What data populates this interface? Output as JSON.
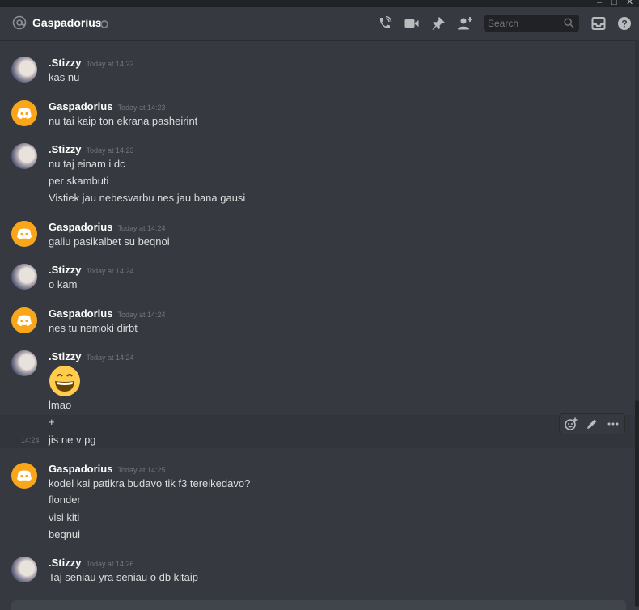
{
  "header": {
    "channel_name": "Gaspadorius",
    "search_placeholder": "Search"
  },
  "messages": [
    {
      "author": ".Stizzy",
      "time": "Today at 14:22",
      "lines": [
        "kas nu"
      ]
    },
    {
      "author": "Gaspadorius",
      "time": "Today at 14:23",
      "lines": [
        "nu tai kaip ton ekrana pasheirint"
      ]
    },
    {
      "author": ".Stizzy",
      "time": "Today at 14:23",
      "lines": [
        "nu taj einam i dc",
        "per skambuti",
        "Vistiek jau nebesvarbu nes jau bana gausi"
      ]
    },
    {
      "author": "Gaspadorius",
      "time": "Today at 14:24",
      "lines": [
        "galiu pasikalbet su beqnoi"
      ]
    },
    {
      "author": ".Stizzy",
      "time": "Today at 14:24",
      "lines": [
        "o kam"
      ]
    },
    {
      "author": "Gaspadorius",
      "time": "Today at 14:24",
      "lines": [
        "nes tu nemoki dirbt"
      ]
    },
    {
      "author": ".Stizzy",
      "time": "Today at 14:24",
      "lines": [
        "lmao",
        "+",
        "jis ne v pg"
      ],
      "emoji": "smile-emoji",
      "hover_time": "14:24"
    },
    {
      "author": "Gaspadorius",
      "time": "Today at 14:25",
      "lines": [
        "kodel kai patikra budavo tik f3 tereikedavo?",
        "flonder",
        "visi kiti",
        "beqnui"
      ]
    },
    {
      "author": ".Stizzy",
      "time": "Today at 14:26",
      "lines": [
        "Taj seniau yra seniau o db kitaip"
      ]
    }
  ],
  "colors": {
    "background": "#36393f",
    "discord_orange": "#faa61a",
    "text": "#dcddde"
  }
}
